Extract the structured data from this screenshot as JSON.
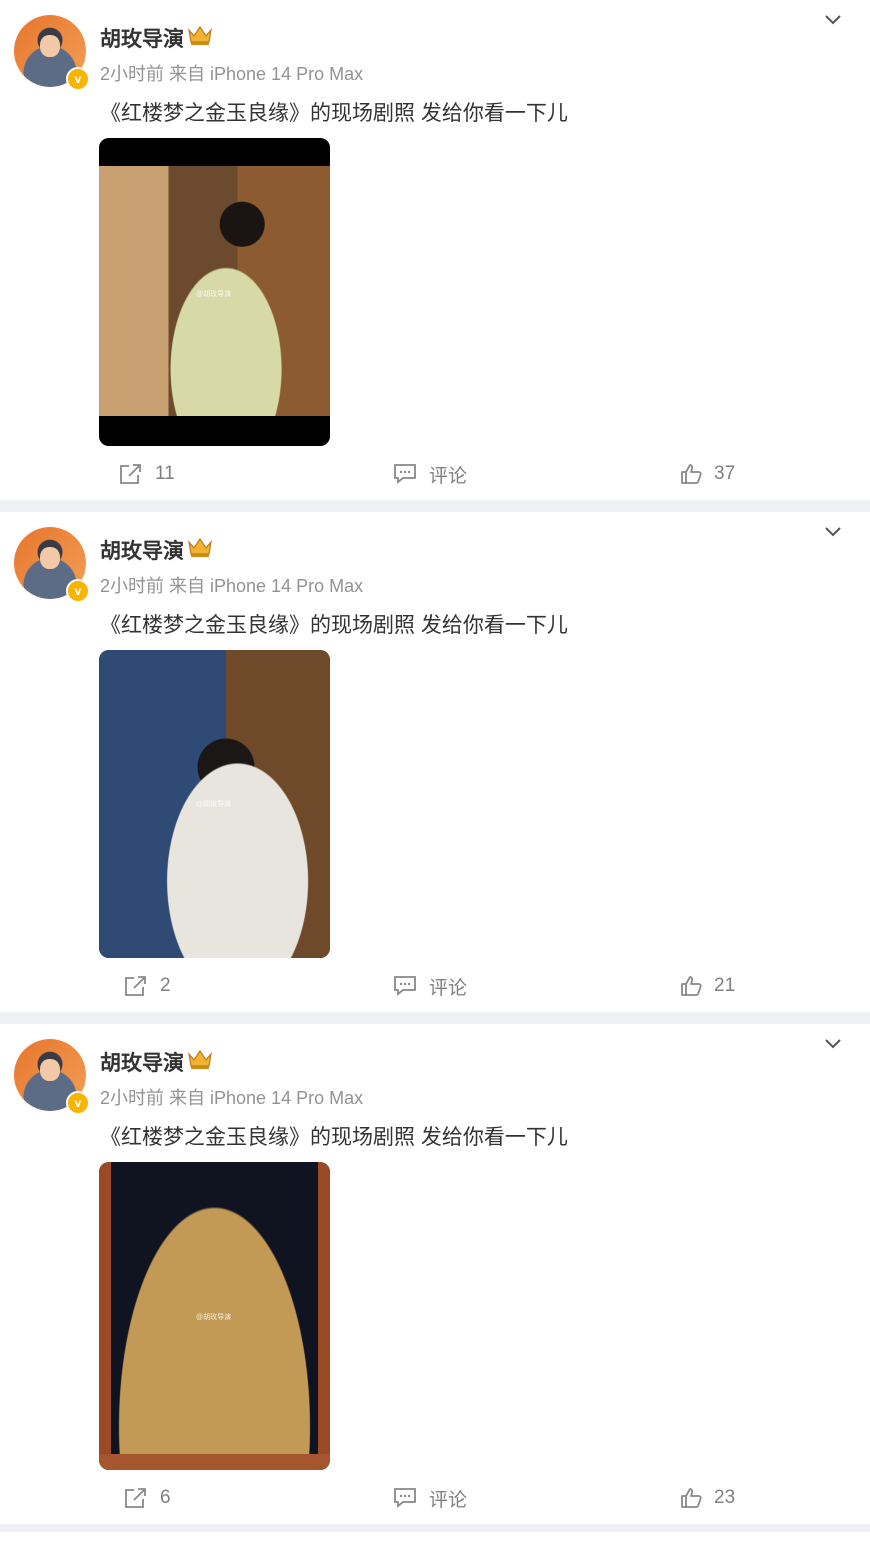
{
  "posts": [
    {
      "author": "胡玫导演",
      "meta": "2小时前 来自 iPhone 14 Pro Max",
      "text": "《红楼梦之金玉良缘》的现场剧照 发给你看一下儿",
      "watermark": "@胡玫导演",
      "reposts": "11",
      "comment_label": "评论",
      "likes": "37"
    },
    {
      "author": "胡玫导演",
      "meta": "2小时前 来自 iPhone 14 Pro Max",
      "text": "《红楼梦之金玉良缘》的现场剧照 发给你看一下儿",
      "watermark": "@胡玫导演",
      "reposts": "2",
      "comment_label": "评论",
      "likes": "21"
    },
    {
      "author": "胡玫导演",
      "meta": "2小时前 来自 iPhone 14 Pro Max",
      "text": "《红楼梦之金玉良缘》的现场剧照 发给你看一下儿",
      "watermark": "@胡玫导演",
      "reposts": "6",
      "comment_label": "评论",
      "likes": "23"
    }
  ],
  "icons": {
    "verified": "verified-v-badge",
    "crown": "member-crown-icon",
    "menu": "chevron-down-icon",
    "repost": "repost-icon",
    "comment": "comment-icon",
    "like": "like-icon"
  },
  "colors": {
    "verified_badge": "#f7b500",
    "separator": "#eef0f3",
    "meta_text": "#939393"
  },
  "badge_letter": "v"
}
